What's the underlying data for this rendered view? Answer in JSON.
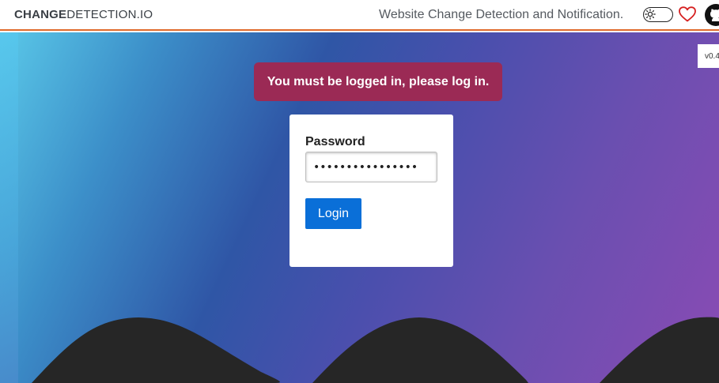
{
  "header": {
    "brand_bold": "CHANGE",
    "brand_light": "DETECTION.IO",
    "tagline": "Website Change Detection and Notification.",
    "toggle_icon": "sun-icon",
    "heart_icon": "heart-icon",
    "github_icon": "github-icon"
  },
  "version": {
    "label": "v0.4"
  },
  "flash": {
    "message": "You must be logged in, please log in."
  },
  "login": {
    "password_label": "Password",
    "password_value": "••••••••••••••••",
    "login_button": "Login"
  },
  "colors": {
    "accent_line": "#e06a2a",
    "flash_bg": "#9b2a55",
    "button_bg": "#0a6fd8",
    "wave": "#262626"
  }
}
